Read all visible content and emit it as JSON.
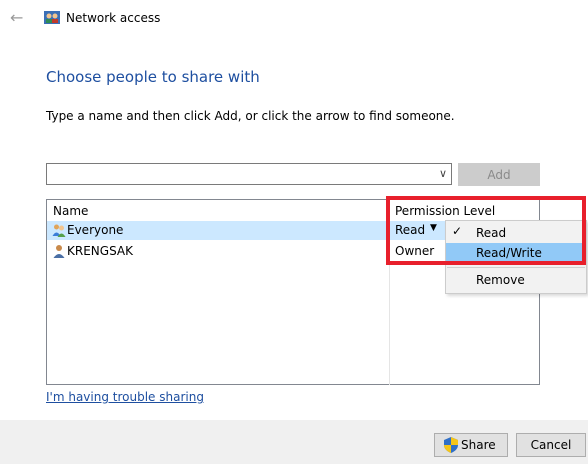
{
  "header": {
    "back_icon": "back-arrow-icon",
    "app_icon": "network-users-icon",
    "title": "Network access"
  },
  "main": {
    "heading": "Choose people to share with",
    "instruction": "Type a name and then click Add, or click the arrow to find someone.",
    "combo": {
      "value": ""
    },
    "add_label": "Add",
    "list": {
      "columns": [
        "Name",
        "Permission Level"
      ],
      "rows": [
        {
          "name": "Everyone",
          "permission": "Read",
          "icon": "group-users-icon",
          "selected": true
        },
        {
          "name": "KRENGSAK",
          "permission": "Owner",
          "icon": "user-icon",
          "selected": false
        }
      ]
    },
    "permission_menu": {
      "items": [
        {
          "label": "Read",
          "checked": true
        },
        {
          "label": "Read/Write",
          "highlighted": true
        },
        {
          "label": "Remove"
        }
      ]
    },
    "trouble_link": "I'm having trouble sharing"
  },
  "footer": {
    "share_label": "Share",
    "cancel_label": "Cancel"
  },
  "colors": {
    "accent": "#1e4fa0",
    "selection": "#cce8ff",
    "menu_highlight": "#91c9f7",
    "annotation_red": "#e8202c"
  }
}
